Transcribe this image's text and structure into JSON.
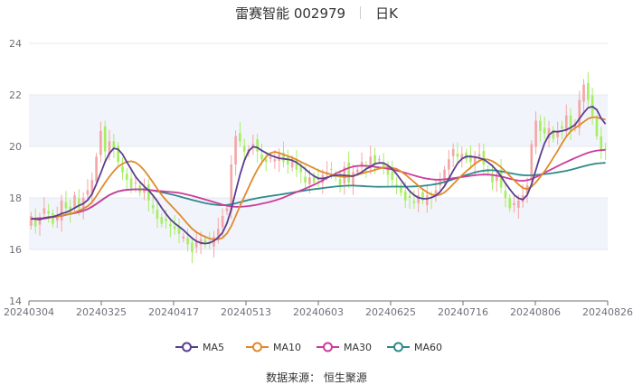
{
  "header": {
    "stock": "雷赛智能 002979",
    "period": "日K"
  },
  "footer": {
    "source": "数据来源： 恒生聚源"
  },
  "colors": {
    "up": "#f4a6a6",
    "down": "#a6ee64",
    "MA5": "#5b3f8f",
    "MA10": "#e08a2a",
    "MA30": "#cc3c9b",
    "MA60": "#2f8a8a",
    "band": "#f2f4fb"
  },
  "chart_data": {
    "type": "candlestick",
    "title": "雷赛智能 002979 日K",
    "x_tick_labels": [
      "20240304",
      "20240325",
      "20240417",
      "20240513",
      "20240603",
      "20240625",
      "20240716",
      "20240806",
      "20240826"
    ],
    "y_ticks": [
      14,
      16,
      18,
      20,
      22,
      24
    ],
    "ylim": [
      14,
      24
    ],
    "grid": true,
    "legend_position": "bottom",
    "legend": [
      "MA5",
      "MA10",
      "MA30",
      "MA60"
    ],
    "closes": [
      17.3,
      16.9,
      17.2,
      17.6,
      17.4,
      17.0,
      17.3,
      17.9,
      17.6,
      17.4,
      18.1,
      17.6,
      18.0,
      18.3,
      18.7,
      19.6,
      20.6,
      19.8,
      20.2,
      19.9,
      19.4,
      19.0,
      18.7,
      18.4,
      18.6,
      18.2,
      18.4,
      17.9,
      17.6,
      17.2,
      17.0,
      17.1,
      16.9,
      16.8,
      16.6,
      16.5,
      16.2,
      15.9,
      16.3,
      16.4,
      16.2,
      16.3,
      16.5,
      16.8,
      17.3,
      17.6,
      19.3,
      20.4,
      20.2,
      19.8,
      19.9,
      20.1,
      19.8,
      19.5,
      19.4,
      19.6,
      19.5,
      19.7,
      19.4,
      19.3,
      19.5,
      19.1,
      19.0,
      18.6,
      18.8,
      18.6,
      18.7,
      18.9,
      19.0,
      19.1,
      18.8,
      18.5,
      19.2,
      18.6,
      19.0,
      19.1,
      19.4,
      19.2,
      19.6,
      19.3,
      19.5,
      19.2,
      18.9,
      18.7,
      18.5,
      18.2,
      17.9,
      18.0,
      17.8,
      18.1,
      17.9,
      18.1,
      18.0,
      18.3,
      18.7,
      19.1,
      19.5,
      19.9,
      19.6,
      19.7,
      19.5,
      19.4,
      19.6,
      19.7,
      19.3,
      19.0,
      18.6,
      18.9,
      18.4,
      18.0,
      17.6,
      17.8,
      17.9,
      18.1,
      18.5,
      20.1,
      21.0,
      20.6,
      20.5,
      20.7,
      20.3,
      20.6,
      20.7,
      21.2,
      20.6,
      20.9,
      21.8,
      22.4,
      21.8,
      21.2,
      20.4,
      19.8,
      19.9
    ]
  }
}
